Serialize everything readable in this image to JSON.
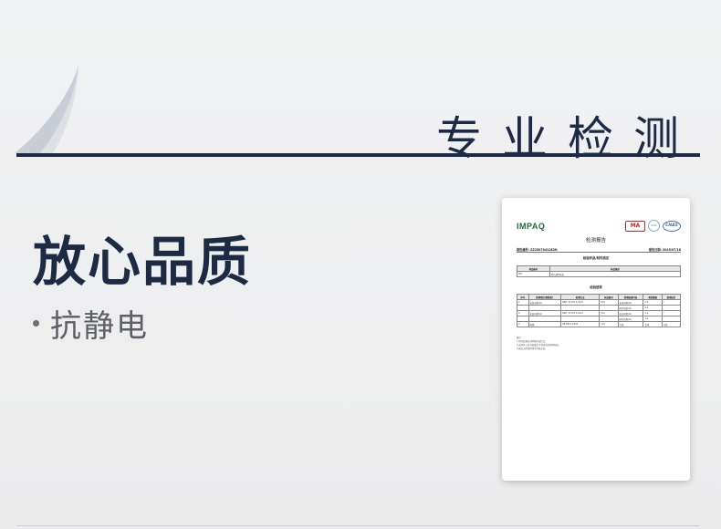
{
  "header": {
    "title": "专业检测"
  },
  "main": {
    "headline": "放心品质",
    "bullet": "抗静电"
  },
  "report": {
    "brand": "IMPAQ",
    "logos": {
      "ma": "MA",
      "ilac": "ILAC",
      "cnas": "CNAS"
    },
    "title": "检测报告",
    "report_no": "报告编号: SZ2507041282N",
    "date": "报告日期: 2025/07/16",
    "sample_section": "检验样品/制件描述",
    "sample_header": [
      "样品编号",
      "样品描述"
    ],
    "sample_row": [
      "001",
      "黑色透明电帘"
    ],
    "result_section": "检验结果",
    "result_header": [
      "序号",
      "检测项目(参数表)",
      "检测方法",
      "样品编号",
      "检测结果内容",
      "测试数据",
      "检测结论"
    ],
    "result_rows": [
      [
        "1",
        "表面电阻(Ω)",
        "GB/T 12703.1-2021",
        "001",
        "表面电阻(Ω)",
        "2.0",
        "/"
      ],
      [
        "",
        "",
        "",
        "",
        "体积电阻(Ω)",
        "2.0",
        ""
      ],
      [
        "2",
        "表面电阻(Ω)",
        "GB/T 12703.1-2021",
        "001",
        "表面电阻(Ω)",
        "2.0",
        "/"
      ],
      [
        "",
        "",
        "",
        "",
        "体积电阻(Ω)",
        "2.0",
        ""
      ],
      [
        "3",
        "阻燃",
        "GB 8410-2006",
        "001",
        "合格",
        "合格",
        "合格"
      ]
    ],
    "notes": [
      "备注:",
      "1.检验结果仅对所检样品负责。",
      "2.未经本公司书面批准,不得部分复制本报告。",
      "3.报告无检验检测专用章无效。"
    ]
  },
  "colors": {
    "navy": "#1c2a44",
    "gray_text": "#5c6066",
    "brand_green": "#1f6a3a"
  }
}
